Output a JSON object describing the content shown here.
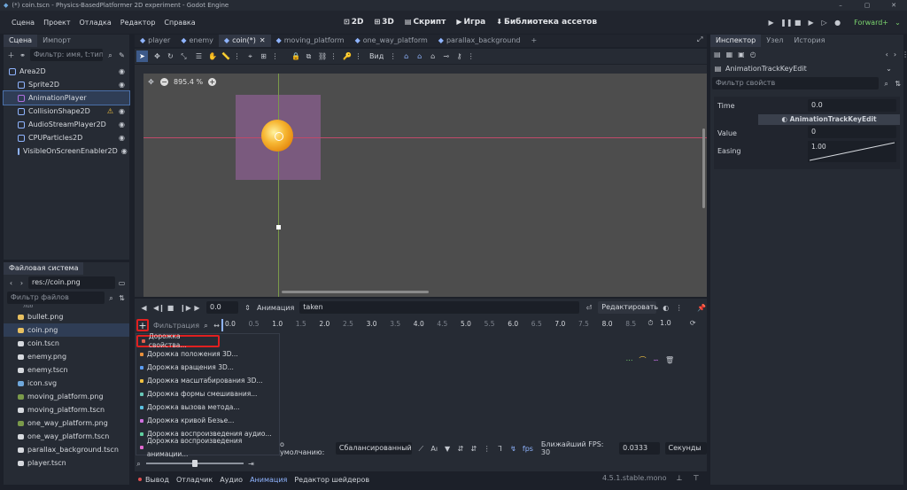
{
  "window": {
    "title": "(*) coin.tscn - Physics-BasedPlatformer 2D experiment - Godot Engine",
    "minimize": "–",
    "maximize": "▢",
    "close": "✕"
  },
  "menu": [
    "Сцена",
    "Проект",
    "Отладка",
    "Редактор",
    "Справка"
  ],
  "modes": [
    "2D",
    "3D",
    "Скрипт",
    "Игра",
    "Библиотека ассетов"
  ],
  "renderer": "Forward+",
  "scene_dock": {
    "tabs": [
      "Сцена",
      "Импорт"
    ],
    "filter_placeholder": "Фильтр: имя, t:тип,",
    "nodes": [
      "Area2D",
      "Sprite2D",
      "AnimationPlayer",
      "CollisionShape2D",
      "AudioStreamPlayer2D",
      "CPUParticles2D",
      "VisibleOnScreenEnabler2D"
    ]
  },
  "fs_dock": {
    "title": "Файловая система",
    "path": "res://coin.png",
    "filter_placeholder": "Фильтр файлов",
    "files": [
      "bullet.png",
      "coin.png",
      "coin.tscn",
      "enemy.png",
      "enemy.tscn",
      "icon.svg",
      "moving_platform.png",
      "moving_platform.tscn",
      "one_way_platform.png",
      "one_way_platform.tscn",
      "parallax_background.tscn",
      "player.tscn"
    ],
    "partial": "лuo"
  },
  "editor_tabs": [
    "player",
    "enemy",
    "coin(*)",
    "moving_platform",
    "one_way_platform",
    "parallax_background"
  ],
  "toolbar": {
    "view": "Вид"
  },
  "viewport": {
    "zoom": "895.4 %"
  },
  "anim": {
    "time": "0.0",
    "label": "Анимация",
    "current": "taken",
    "edit": "Редактировать",
    "filter": "Фильтрация",
    "ticks": [
      "0.0",
      "0.5",
      "1.0",
      "1.5",
      "2.0",
      "2.5",
      "3.0",
      "3.5",
      "4.0",
      "4.5",
      "5.0",
      "5.5",
      "6.0",
      "6.5",
      "7.0",
      "7.5",
      "8.0",
      "8.5"
    ],
    "length": "1.0",
    "default_label": "о умолчанию:",
    "interp": "Сбалансированный",
    "snap_label": "Ближайший FPS: 30",
    "snap_val": "0.0333",
    "units": "Секунды"
  },
  "track_menu": [
    "Дорожка свойства...",
    "Дорожка положения 3D...",
    "Дорожка вращения 3D...",
    "Дорожка масштабирования 3D...",
    "Дорожка формы смешивания...",
    "Дорожка вызова метода...",
    "Дорожка кривой Безье...",
    "Дорожка воспроизведения аудио...",
    "Дорожка воспроизведения анимации..."
  ],
  "track_colors": [
    "#e0604e",
    "#e8903c",
    "#5b9cf0",
    "#f0c040",
    "#68c8b8",
    "#5cc0e0",
    "#d070e0",
    "#60d0a0",
    "#e06ad0"
  ],
  "bottom": {
    "tabs": [
      "Вывод",
      "Отладчик",
      "Аудио",
      "Анимация",
      "Редактор шейдеров"
    ],
    "version": "4.5.1.stable.mono"
  },
  "inspector": {
    "tabs": [
      "Инспектор",
      "Узел",
      "История"
    ],
    "object": "AnimationTrackKeyEdit",
    "filter_placeholder": "Фильтр свойств",
    "time_label": "Time",
    "time_val": "0.0",
    "section": "AnimationTrackKeyEdit",
    "value_label": "Value",
    "value_val": "0",
    "easing_label": "Easing",
    "easing_val": "1.00"
  },
  "colors": {
    "accent": "#8fb4ff",
    "highlight": "#e02020"
  }
}
